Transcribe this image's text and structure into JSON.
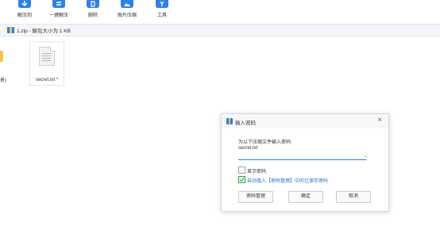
{
  "toolbar": {
    "items": [
      {
        "label": "解压到",
        "icon": "extract-icon"
      },
      {
        "label": "一键解压",
        "icon": "one-click-extract-icon"
      },
      {
        "label": "删除",
        "icon": "delete-icon"
      },
      {
        "label": "图片压缩",
        "icon": "image-compress-icon"
      },
      {
        "label": "工具",
        "icon": "tools-icon"
      }
    ]
  },
  "address": {
    "path": "1.zip - 解包大小为 1 KB"
  },
  "files": {
    "folder_label": "景)",
    "file_name": "secret.txt *"
  },
  "dialog": {
    "title": "输入密码",
    "prompt": "为以下压缩文件输入密码:",
    "file_name": "secret.txt",
    "password_value": "",
    "show_password_label": "显示密码",
    "show_password_checked": false,
    "auto_fill_label": "自动填入【密码管理】中的已保存密码",
    "auto_fill_checked": true,
    "buttons": {
      "manage": "密码管理",
      "ok": "确定",
      "cancel": "取消"
    }
  },
  "colors": {
    "accent": "#2f7fe0",
    "link_text": "#2f6fd0",
    "check": "#2aa14a"
  }
}
